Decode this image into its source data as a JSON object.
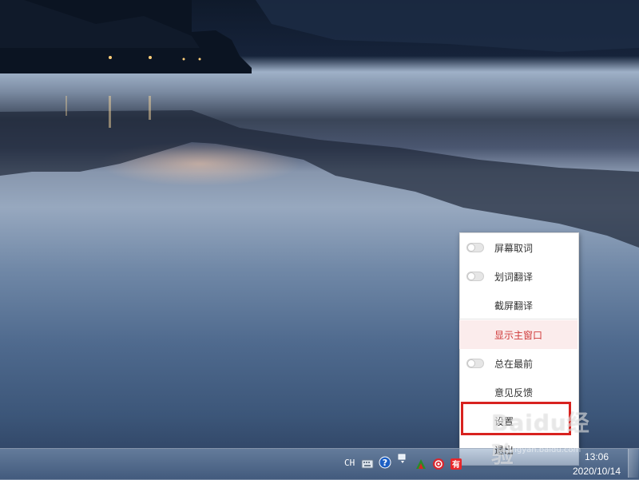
{
  "context_menu": {
    "items": [
      {
        "label": "屏幕取词",
        "has_toggle": true,
        "toggle_on": false
      },
      {
        "label": "划词翻译",
        "has_toggle": true,
        "toggle_on": false
      },
      {
        "label": "截屏翻译",
        "has_toggle": false
      },
      {
        "label": "显示主窗口",
        "has_toggle": false,
        "highlighted": true
      },
      {
        "label": "总在最前",
        "has_toggle": true,
        "toggle_on": false
      },
      {
        "label": "意见反馈",
        "has_toggle": false
      },
      {
        "label": "设置",
        "has_toggle": false,
        "annotated": true
      },
      {
        "label": "退出",
        "has_toggle": false
      }
    ],
    "highlight_color": "#d03a3a",
    "annotation_color": "#d8221f"
  },
  "taskbar": {
    "language_indicator": "CH",
    "tray_icons": [
      "keyboard-icon",
      "help-icon",
      "network-icon",
      "up-arrow-icon",
      "red-tool-icon",
      "target-icon",
      "youdao-icon"
    ],
    "clock": {
      "time": "13:06",
      "date": "2020/10/14"
    }
  },
  "watermark": {
    "logo": "Baidu经验",
    "url": "jingyan.baidu.com"
  }
}
